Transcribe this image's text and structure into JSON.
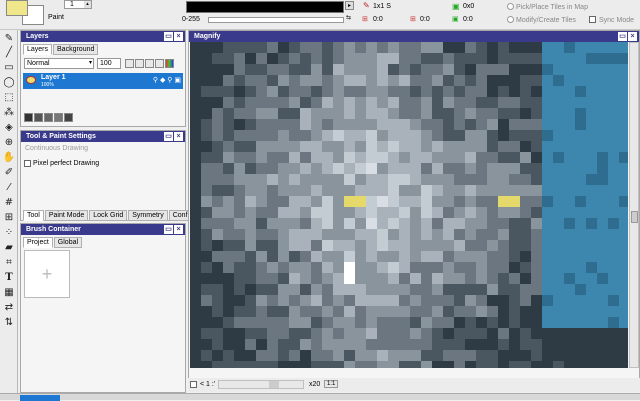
{
  "toolbar": {
    "paint_label": "Paint",
    "number_value": "1",
    "range_label": "0-255",
    "tile_size_label": "1x1 S",
    "hex_label": "0x0",
    "coord1": "0:0",
    "coord2": "0:0",
    "coord3": "0:0",
    "pick_place_label": "Pick/Place Tiles in Map",
    "modify_create_label": "Modify/Create Tiles",
    "sync_mode_label": "Sync Mode",
    "fg_color": "#f0e68c",
    "bg_color": "#ffffff"
  },
  "layers_panel": {
    "title": "Layers",
    "tabs": [
      "Layers",
      "Background"
    ],
    "blend_mode": "Normal",
    "opacity": "100",
    "layer": {
      "name": "Layer 1",
      "opacity": "100%"
    }
  },
  "tool_settings": {
    "title": "Tool & Paint Settings",
    "continuous_drawing": "Continuous Drawing",
    "pixel_perfect": "Pixel perfect Drawing",
    "tabs": [
      "Tool",
      "Paint Mode",
      "Lock Grid",
      "Symmetry",
      "Conf"
    ]
  },
  "brush_container": {
    "title": "Brush Container",
    "tabs": [
      "Project",
      "Global"
    ],
    "add_symbol": "+"
  },
  "magnify": {
    "title": "Magnify",
    "zoom_label": "x20",
    "ratio_button": "1:1",
    "status_label": "< 1 :'"
  },
  "colors": {
    "panel_title": "#3a3a8c",
    "selected_layer": "#1e78d2",
    "eye": "#f0dc6e",
    "canvas_blue": "#3d86ad"
  },
  "tools": [
    "pencil-icon",
    "line-icon",
    "rect-icon",
    "ellipse-icon",
    "select-icon",
    "wand-icon",
    "fill-icon",
    "zoom-icon",
    "hand-icon",
    "brush-icon",
    "dropper-icon",
    "grid-icon",
    "stamp-icon",
    "spray-icon",
    "eraser-icon",
    "crop-icon",
    "text-icon",
    "tile-icon",
    "swap-icon",
    "replace-icon"
  ]
}
